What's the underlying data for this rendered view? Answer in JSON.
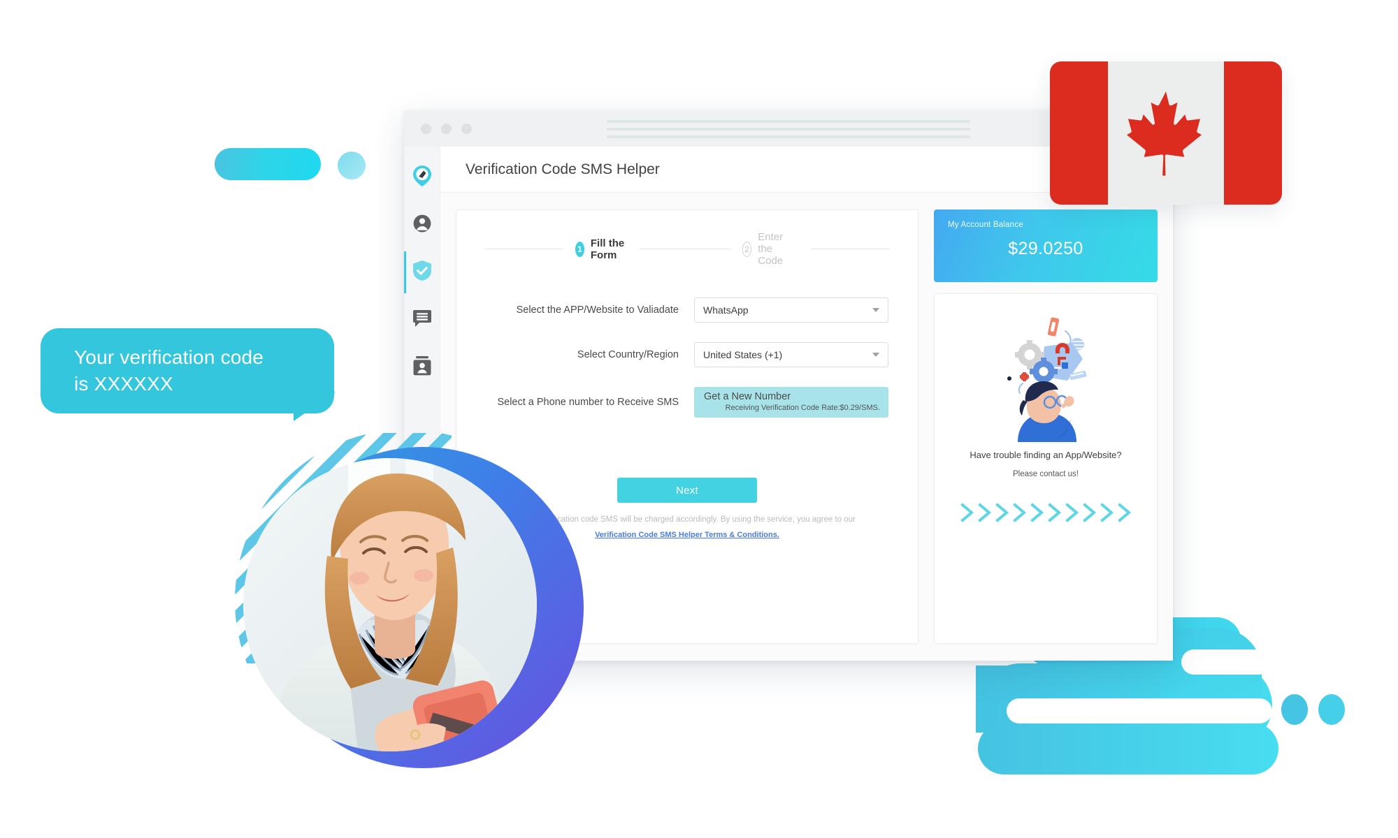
{
  "browser": {
    "window_controls": [
      "close",
      "minimize",
      "maximize"
    ],
    "address_bar_placeholder": ""
  },
  "sidebar": {
    "items": [
      {
        "name": "logo-pin",
        "icon": "location-pin-icon",
        "active": false
      },
      {
        "name": "account",
        "icon": "user-icon",
        "active": false
      },
      {
        "name": "verification",
        "icon": "shield-check-icon",
        "active": true
      },
      {
        "name": "messages",
        "icon": "message-icon",
        "active": false
      },
      {
        "name": "contacts",
        "icon": "contact-card-icon",
        "active": false
      }
    ]
  },
  "app": {
    "title": "Verification Code SMS Helper"
  },
  "stepper": {
    "steps": [
      {
        "num": "1",
        "label": "Fill the Form",
        "active": true
      },
      {
        "num": "2",
        "label": "Enter the Code",
        "active": false
      }
    ]
  },
  "form": {
    "rows": [
      {
        "label": "Select the APP/Website to Valiadate",
        "value": "WhatsApp",
        "type": "select"
      },
      {
        "label": "Select Country/Region",
        "value": "United States (+1)",
        "type": "select"
      },
      {
        "label": "Select a Phone number to Receive SMS",
        "value": "Get a New Number",
        "type": "button"
      }
    ],
    "number_button": {
      "title": "Get a New Number",
      "rate": "Receiving Verification Code Rate:$0.29/SMS."
    },
    "next_label": "Next",
    "terms_text": "Each Verification code SMS will be charged accordingly. By using the service, you agree to our",
    "terms_link": "Verification Code SMS Helper Terms & Conditions."
  },
  "balance": {
    "label": "My Account Balance",
    "amount": "$29.0250"
  },
  "help": {
    "line1": "Have trouble finding an App/Website?",
    "line2": "Please contact us!",
    "chevron_count": 10,
    "illustration": "person-thinking-lock-illustration"
  },
  "sms_bubble": {
    "line1": "Your verification code",
    "line2": "is XXXXXX"
  },
  "flag": {
    "country": "Canada",
    "icon": "canada-flag-icon"
  },
  "photo": {
    "alt": "woman-using-smartphone-photo"
  },
  "colors": {
    "accent_cyan": "#3fcfe3",
    "accent_cyan_dark": "#33c6dd",
    "link_blue": "#4a7ce0",
    "flag_red": "#dc2b1f",
    "number_button_bg": "#a9e3ea",
    "text_dark": "#424242",
    "text_muted": "#b8bcbf"
  }
}
